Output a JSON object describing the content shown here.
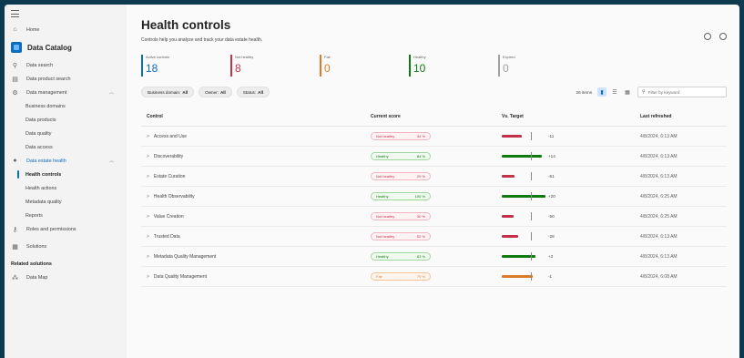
{
  "colors": {
    "accent": "#0f6cbd",
    "unhealthy": "#c4314b",
    "healthy": "#107c10",
    "fair": "#da7b2a",
    "expired": "#8a8a8a"
  },
  "sidebar": {
    "home": "Home",
    "catalog_title": "Data Catalog",
    "items": {
      "data_search": "Data search",
      "data_product_search": "Data product search",
      "data_management": "Data management",
      "business_domains": "Business domains",
      "data_products": "Data products",
      "data_quality": "Data quality",
      "data_access": "Data access",
      "data_estate_health": "Data estate health",
      "health_controls": "Health controls",
      "health_actions": "Health actions",
      "metadata_quality": "Metadata quality",
      "reports": "Reports",
      "roles_permissions": "Roles and permissions",
      "solutions": "Solutions"
    },
    "related_title": "Related solutions",
    "data_map": "Data Map"
  },
  "header": {
    "title": "Health controls",
    "subtitle": "Controls help you analyze and track your data estate health."
  },
  "stats": [
    {
      "label": "Active controls",
      "value": "18",
      "color": "#0f6cbd"
    },
    {
      "label": "Not healthy",
      "value": "8",
      "color": "#c4314b"
    },
    {
      "label": "Fair",
      "value": "0",
      "color": "#da7b2a"
    },
    {
      "label": "Healthy",
      "value": "10",
      "color": "#107c10"
    },
    {
      "label": "Expired",
      "value": "0",
      "color": "#a0a0a0"
    }
  ],
  "filters": [
    {
      "label": "Business domain:",
      "value": "All"
    },
    {
      "label": "Owner:",
      "value": "All"
    },
    {
      "label": "Status:",
      "value": "All"
    }
  ],
  "toolbar": {
    "count": "26 items",
    "search_placeholder": "Filter by keyword"
  },
  "table": {
    "headers": {
      "control": "Control",
      "score": "Current score",
      "target": "Vs. Target",
      "refreshed": "Last refreshed"
    },
    "rows": [
      {
        "name": "Access and Use",
        "status": "Not healthy",
        "score": "34 %",
        "kind": "bad",
        "delta": "-11",
        "fill": 0.46,
        "refreshed": "4/8/2024, 6:13 AM"
      },
      {
        "name": "Discoverability",
        "status": "Healthy",
        "score": "84 %",
        "kind": "good",
        "delta": "+14",
        "fill": 0.92,
        "refreshed": "4/8/2024, 6:13 AM"
      },
      {
        "name": "Estate Curation",
        "status": "Not healthy",
        "score": "29 %",
        "kind": "bad",
        "delta": "-51",
        "fill": 0.3,
        "refreshed": "4/8/2024, 6:13 AM"
      },
      {
        "name": "Health Observability",
        "status": "Healthy",
        "score": "100 %",
        "kind": "good",
        "delta": "+20",
        "fill": 0.99,
        "refreshed": "4/8/2024, 6:25 AM"
      },
      {
        "name": "Value Creation",
        "status": "Not healthy",
        "score": "30 %",
        "kind": "bad",
        "delta": "-50",
        "fill": 0.28,
        "refreshed": "4/8/2024, 6:25 AM"
      },
      {
        "name": "Trusted Data",
        "status": "Not healthy",
        "score": "52 %",
        "kind": "bad",
        "delta": "-28",
        "fill": 0.38,
        "refreshed": "4/8/2024, 6:13 AM"
      },
      {
        "name": "Metadata Quality Management",
        "status": "Healthy",
        "score": "83 %",
        "kind": "good",
        "delta": "+3",
        "fill": 0.78,
        "refreshed": "4/8/2024, 6:13 AM"
      },
      {
        "name": "Data Quality Management",
        "status": "Fair",
        "score": "79 %",
        "kind": "fair",
        "delta": "-1",
        "fill": 0.7,
        "refreshed": "4/8/2024, 6:08 AM"
      }
    ]
  }
}
